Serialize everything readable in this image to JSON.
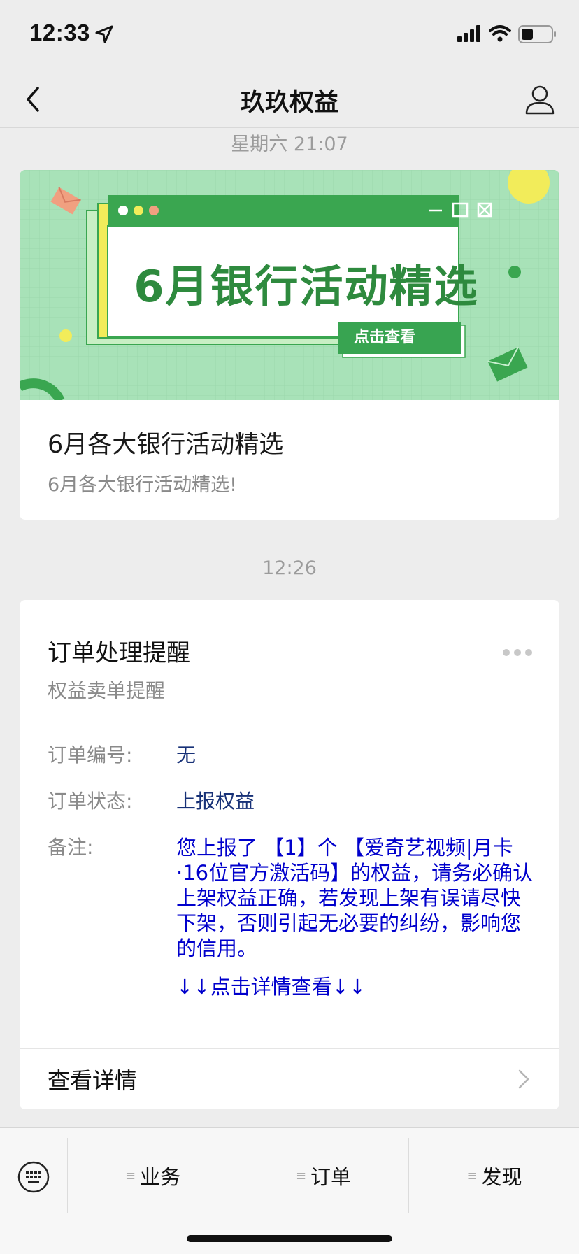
{
  "status_bar": {
    "time": "12:33"
  },
  "nav": {
    "title": "玖玖权益"
  },
  "article": {
    "timestamp": "星期六 21:07",
    "banner_headline": "6月银行活动精选",
    "banner_button": "点击查看",
    "title": "6月各大银行活动精选",
    "description": "6月各大银行活动精选!"
  },
  "order": {
    "timestamp": "12:26",
    "title": "订单处理提醒",
    "subtitle": "权益卖单提醒",
    "fields": [
      {
        "label": "订单编号:",
        "value": "无"
      },
      {
        "label": "订单状态:",
        "value": "上报权益"
      }
    ],
    "remark_label": "备注:",
    "remark_text": "您上报了 【1】个 【爱奇艺视频|月卡·16位官方激活码】的权益，请务必确认上架权益正确，若发现上架有误请尽快下架，否则引起无必要的纠纷，影响您的信用。",
    "remark_link": "↓↓点击详情查看↓↓",
    "view_details": "查看详情"
  },
  "menu": {
    "items": [
      {
        "label": "业务"
      },
      {
        "label": "订单"
      },
      {
        "label": "发现"
      }
    ]
  },
  "colors": {
    "page_bg": "#ededed",
    "banner_bg": "#a8e2b8",
    "banner_green": "#38a451",
    "remark_blue": "#0000cc",
    "value_navy": "#173177"
  }
}
